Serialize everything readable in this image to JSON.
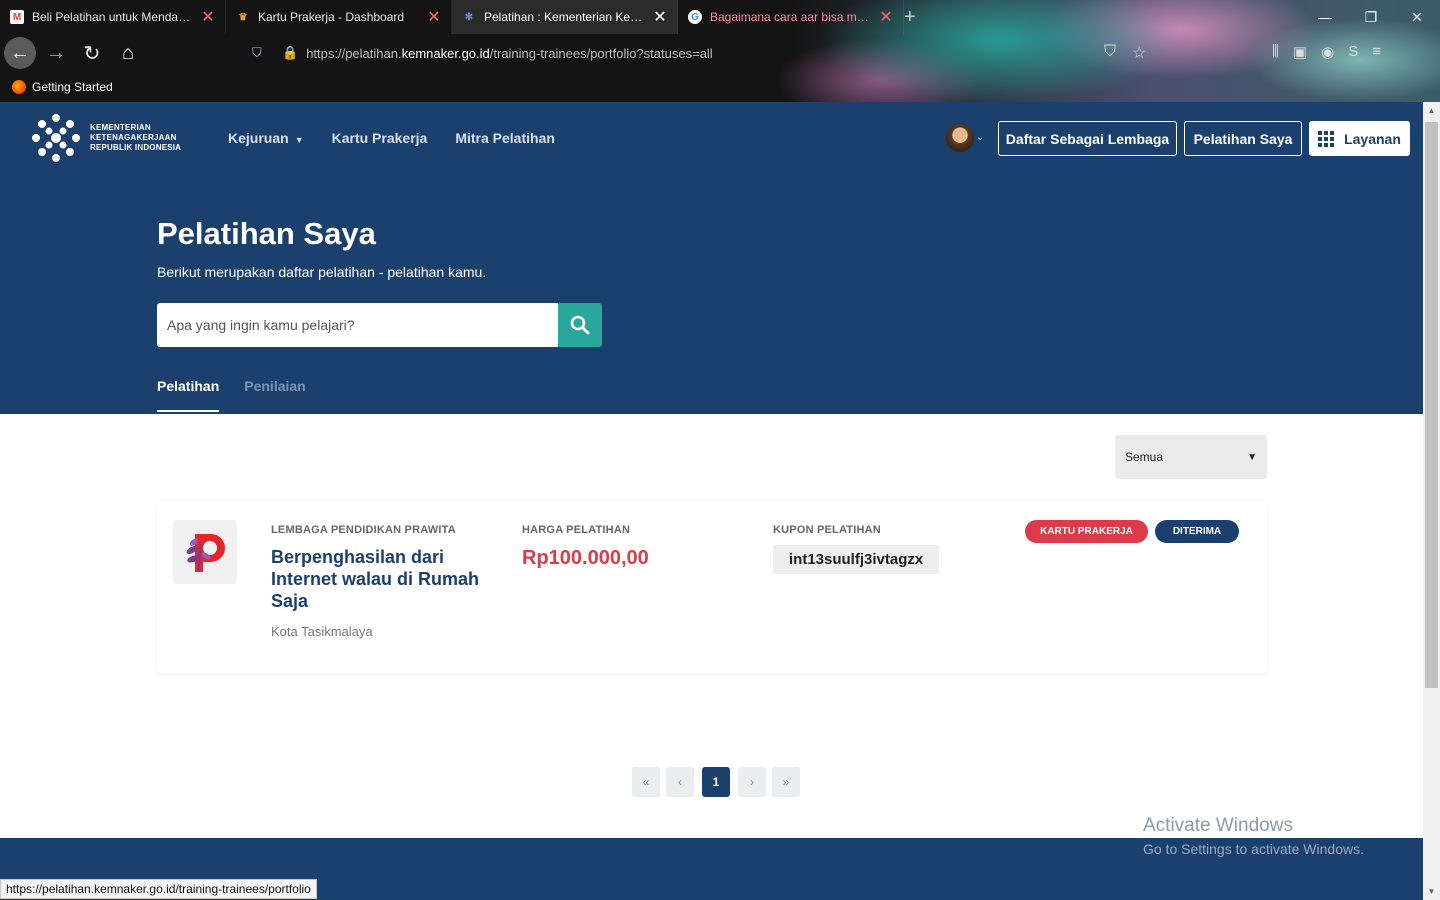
{
  "browser": {
    "tabs": [
      {
        "title": "Beli Pelatihan untuk Mendapatkan Sertifikat",
        "favicon": "gmail-icon"
      },
      {
        "title": "Kartu Prakerja - Dashboard",
        "favicon": "garuda-icon"
      },
      {
        "title": "Pelatihan : Kementerian Ketenagakerjaan",
        "favicon": "kemnaker-icon"
      },
      {
        "title": "Bagaimana cara aar bisa mengikuti",
        "favicon": "google-icon"
      }
    ],
    "url_prefix": "https://pelatihan.",
    "url_domain": "kemnaker.go.id",
    "url_path": "/training-trainees/portfolio?statuses=all",
    "bookmark": "Getting Started",
    "profile_letter": "S",
    "status_url": "https://pelatihan.kemnaker.go.id/training-trainees/portfolio"
  },
  "site": {
    "logo_lines": [
      "KEMENTERIAN",
      "KETENAGAKERJAAN",
      "REPUBLIK INDONESIA"
    ],
    "menu": [
      "Kejuruan",
      "Kartu Prakerja",
      "Mitra Pelatihan"
    ],
    "buttons": {
      "lembaga": "Daftar Sebagai Lembaga",
      "saya": "Pelatihan Saya",
      "layanan": "Layanan"
    }
  },
  "hero": {
    "title": "Pelatihan Saya",
    "subtitle": "Berikut merupakan daftar pelatihan - pelatihan kamu.",
    "search_placeholder": "Apa yang ingin kamu pelajari?",
    "tabs": [
      "Pelatihan",
      "Penilaian"
    ]
  },
  "filter": {
    "selected": "Semua"
  },
  "training": {
    "institution_label": "LEMBAGA PENDIDIKAN PRAWITA",
    "title": "Berpenghasilan dari Internet walau di Rumah Saja",
    "city": "Kota Tasikmalaya",
    "price_label": "HARGA PELATIHAN",
    "price": "Rp100.000,00",
    "coupon_label": "KUPON PELATIHAN",
    "coupon": "int13suulfj3ivtagzx",
    "badges": [
      "KARTU PRAKERJA",
      "DITERIMA"
    ]
  },
  "pagination": {
    "first": "«",
    "prev": "‹",
    "current": "1",
    "next": "›",
    "last": "»"
  },
  "watermark": {
    "line1": "Activate Windows",
    "line2": "Go to Settings to activate Windows."
  },
  "colors": {
    "primary": "#1c406e",
    "accent": "#2aa79b",
    "danger": "#dd3a4a"
  }
}
